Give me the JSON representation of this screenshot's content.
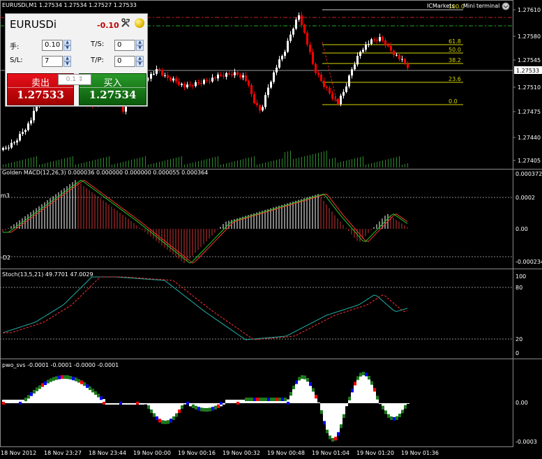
{
  "window": {
    "header": "EURUSDi,M1  1.27534  1.27534  1.27527  1.27533",
    "broker_label": "ICMarkets",
    "mini_terminal_label": "Mini terminal"
  },
  "trade_panel": {
    "symbol": "EURUSDi",
    "profit": "-0.10",
    "lot_label": "手:",
    "lot_value": "0.10",
    "sl_label": "S/L:",
    "sl_value": "7",
    "ts_label": "T/S:",
    "ts_value": "0",
    "tp_label": "T/P:",
    "tp_value": "0",
    "sell_label": "卖出",
    "sell_price": "1.27533",
    "buy_label": "买入",
    "buy_price": "1.27534",
    "lot_step": "0.1"
  },
  "price_axis": {
    "labels": [
      "1.27610",
      "1.27580",
      "1.27545",
      "1.27510",
      "1.27475",
      "1.27440",
      "1.27405"
    ],
    "current_price": "1.27533"
  },
  "fibonacci": {
    "levels": [
      "100.0",
      "61.8",
      "50.0",
      "38.2",
      "23.6",
      "0.0"
    ]
  },
  "macd": {
    "title": "Golden MACD(12,26,3) 0.000036 0.000000 0.000000 0.000055 0.000364",
    "axis_labels": [
      "0.000372",
      "0.0002",
      "0.00",
      "-0.000234"
    ],
    "left_labels": [
      "m3",
      "-D2"
    ]
  },
  "stoch": {
    "title": "Stoch(13,5,21) 49.7701 47.0029",
    "axis_labels": [
      "100",
      "80",
      "20",
      "0"
    ]
  },
  "pwo": {
    "title": "pwo_svs -0.0001 -0.0001 -0.0000 -0.0001",
    "axis_labels": [
      "0.00",
      "-0.0003"
    ]
  },
  "time_axis": {
    "labels": [
      "18 Nov 2012",
      "18 Nov 23:27",
      "18 Nov 23:44",
      "19 Nov 00:00",
      "19 Nov 00:16",
      "19 Nov 00:32",
      "19 Nov 00:48",
      "19 Nov 01:04",
      "19 Nov 01:20",
      "19 Nov 01:36"
    ]
  },
  "colors": {
    "bull": "#ffffff",
    "bear": "#ff0000",
    "volume": "#2e8b2e",
    "fib": "#d8d800",
    "macd_hist_up": "#ffffff",
    "macd_hist_down": "#cc3333",
    "signal_green": "#22cc22",
    "signal_red": "#ff3333",
    "stoch_main": "#20b2aa",
    "stoch_signal": "#ff3333",
    "pwo_green": "#1b7a1b",
    "pwo_blue": "#0000ff",
    "pwo_red": "#ff0000",
    "pwo_white": "#ffffff"
  }
}
